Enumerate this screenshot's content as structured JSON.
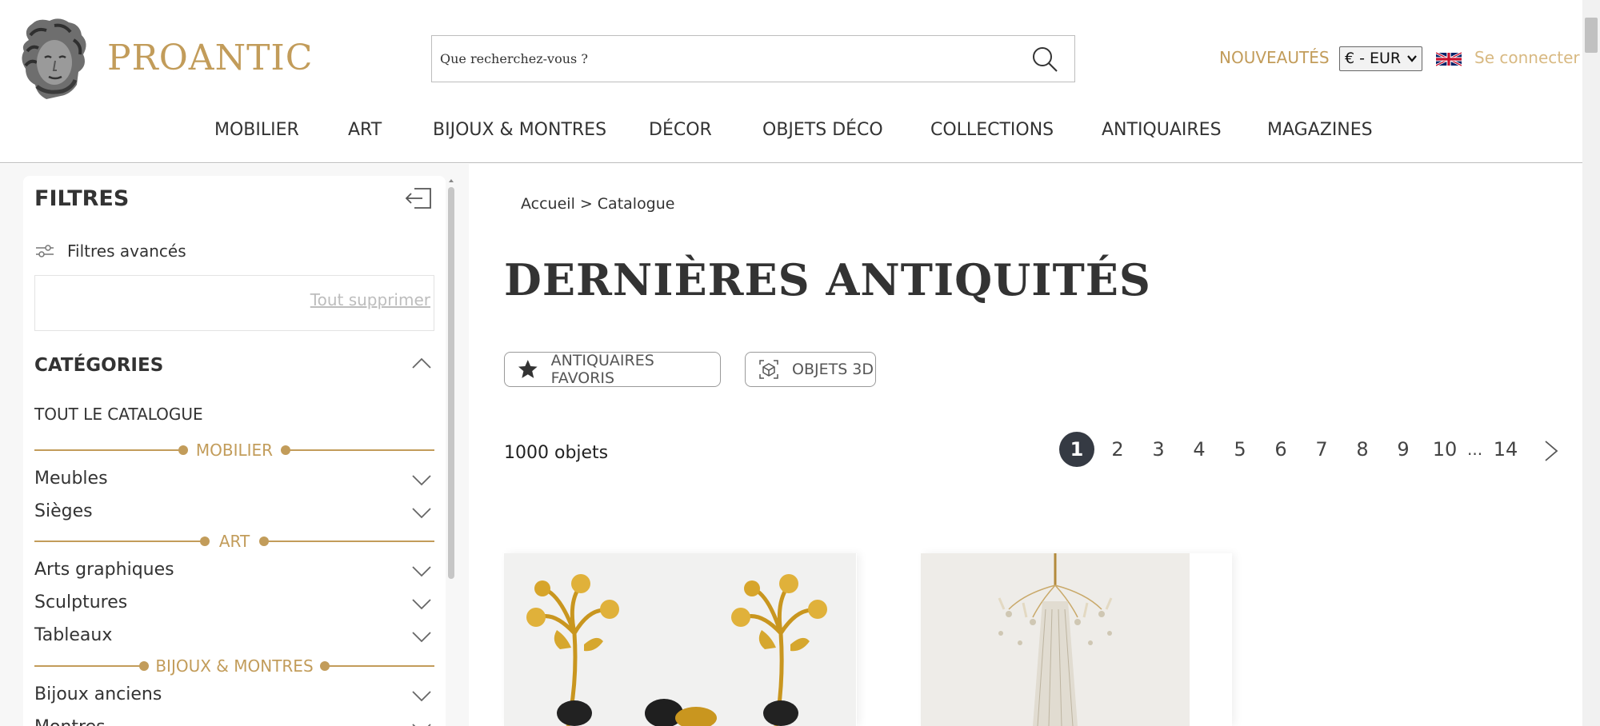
{
  "header": {
    "logo_text": "PROANTIC",
    "search": {
      "placeholder": "Que recherchez-vous ?"
    },
    "nouveautes": "NOUVEAUTÉS",
    "currency": "€ - EUR",
    "signin": "Se connecter"
  },
  "nav": [
    "MOBILIER",
    "ART",
    "BIJOUX & MONTRES",
    "DÉCOR",
    "OBJETS DÉCO",
    "COLLECTIONS",
    "ANTIQUAIRES",
    "MAGAZINES"
  ],
  "sidebar": {
    "title": "FILTRES",
    "advanced": "Filtres avancés",
    "clear_all": "Tout supprimer",
    "categories_title": "CATÉGORIES",
    "all_catalog": "TOUT LE CATALOGUE",
    "groups": {
      "mobilier": {
        "label": "MOBILIER",
        "items": [
          "Meubles",
          "Sièges"
        ]
      },
      "art": {
        "label": "ART",
        "items": [
          "Arts graphiques",
          "Sculptures",
          "Tableaux"
        ]
      },
      "bijoux": {
        "label": "BIJOUX & MONTRES",
        "items": [
          "Bijoux anciens",
          "Montres"
        ]
      }
    }
  },
  "main": {
    "breadcrumb": {
      "home": "Accueil",
      "separator": ">",
      "current": "Catalogue"
    },
    "title": "DERNIÈRES ANTIQUITÉS",
    "pills": {
      "favorites": "ANTIQUAIRES FAVORIS",
      "objects3d": "OBJETS 3D"
    },
    "count": "1000 objets",
    "pagination": {
      "pages": [
        "1",
        "2",
        "3",
        "4",
        "5",
        "6",
        "7",
        "8",
        "9",
        "10"
      ],
      "ellipsis": "...",
      "last": "14",
      "current": "1"
    }
  },
  "colors": {
    "accent": "#c29c5a",
    "text": "#333333",
    "active_page": "#353a43"
  },
  "icons": [
    "search-icon",
    "panel-close-icon",
    "sliders-icon",
    "chevron-up-icon",
    "chevron-down-icon",
    "star-icon",
    "cube-3d-icon",
    "chevron-right-icon",
    "uk-flag-icon"
  ]
}
